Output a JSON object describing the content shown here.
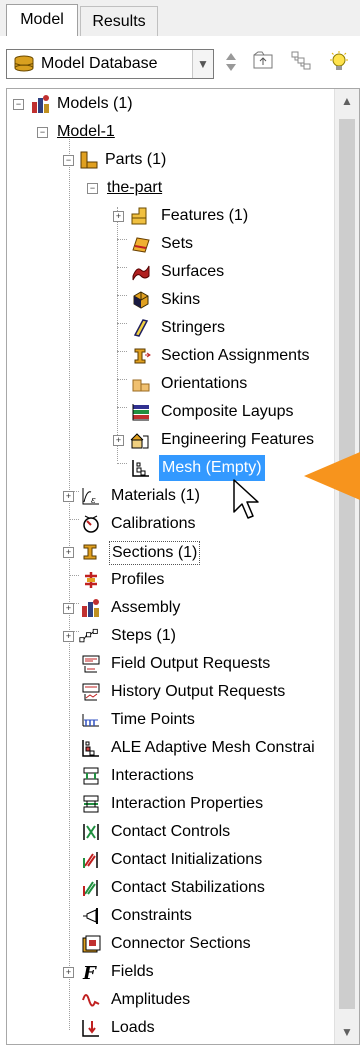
{
  "tabs": [
    {
      "label": "Model",
      "active": true
    },
    {
      "label": "Results",
      "active": false
    }
  ],
  "toolbar": {
    "combo_value": "Model Database"
  },
  "tree": [
    {
      "label": "Models (1)",
      "icon": "models-icon",
      "expander": "minus"
    },
    {
      "label": "Model-1",
      "icon": "none",
      "expander": "minus",
      "underline": true
    },
    {
      "label": "Parts (1)",
      "icon": "parts-icon",
      "expander": "minus"
    },
    {
      "label": "the-part",
      "icon": "none",
      "expander": "minus",
      "underline": true
    },
    {
      "label": "Features (1)",
      "icon": "features-icon",
      "expander": "plus"
    },
    {
      "label": "Sets",
      "icon": "sets-icon"
    },
    {
      "label": "Surfaces",
      "icon": "surfaces-icon"
    },
    {
      "label": "Skins",
      "icon": "skins-icon"
    },
    {
      "label": "Stringers",
      "icon": "stringers-icon"
    },
    {
      "label": "Section Assignments",
      "icon": "section-assignments-icon"
    },
    {
      "label": "Orientations",
      "icon": "orientations-icon"
    },
    {
      "label": "Composite Layups",
      "icon": "composite-layups-icon"
    },
    {
      "label": "Engineering Features",
      "icon": "engineering-features-icon",
      "expander": "plus"
    },
    {
      "label": "Mesh (Empty)",
      "icon": "mesh-icon",
      "selected": true
    },
    {
      "label": "Materials (1)",
      "icon": "materials-icon",
      "expander": "plus"
    },
    {
      "label": "Calibrations",
      "icon": "calibrations-icon"
    },
    {
      "label": "Sections (1)",
      "icon": "sections-icon",
      "expander": "plus",
      "focused": true
    },
    {
      "label": "Profiles",
      "icon": "profiles-icon"
    },
    {
      "label": "Assembly",
      "icon": "assembly-icon",
      "expander": "plus"
    },
    {
      "label": "Steps (1)",
      "icon": "steps-icon",
      "expander": "plus"
    },
    {
      "label": "Field Output Requests",
      "icon": "field-output-icon"
    },
    {
      "label": "History Output Requests",
      "icon": "history-output-icon"
    },
    {
      "label": "Time Points",
      "icon": "time-points-icon"
    },
    {
      "label": "ALE Adaptive Mesh Constrai",
      "icon": "ale-adaptive-mesh-icon"
    },
    {
      "label": "Interactions",
      "icon": "interactions-icon"
    },
    {
      "label": "Interaction Properties",
      "icon": "interaction-properties-icon"
    },
    {
      "label": "Contact Controls",
      "icon": "contact-controls-icon"
    },
    {
      "label": "Contact Initializations",
      "icon": "contact-initializations-icon"
    },
    {
      "label": "Contact Stabilizations",
      "icon": "contact-stabilizations-icon"
    },
    {
      "label": "Constraints",
      "icon": "constraints-icon"
    },
    {
      "label": "Connector Sections",
      "icon": "connector-sections-icon"
    },
    {
      "label": "Fields",
      "icon": "fields-icon",
      "expander": "plus"
    },
    {
      "label": "Amplitudes",
      "icon": "amplitudes-icon"
    },
    {
      "label": "Loads",
      "icon": "loads-icon"
    }
  ],
  "colors": {
    "selection": "#3399ff",
    "callout_arrow": "#f7941d"
  }
}
